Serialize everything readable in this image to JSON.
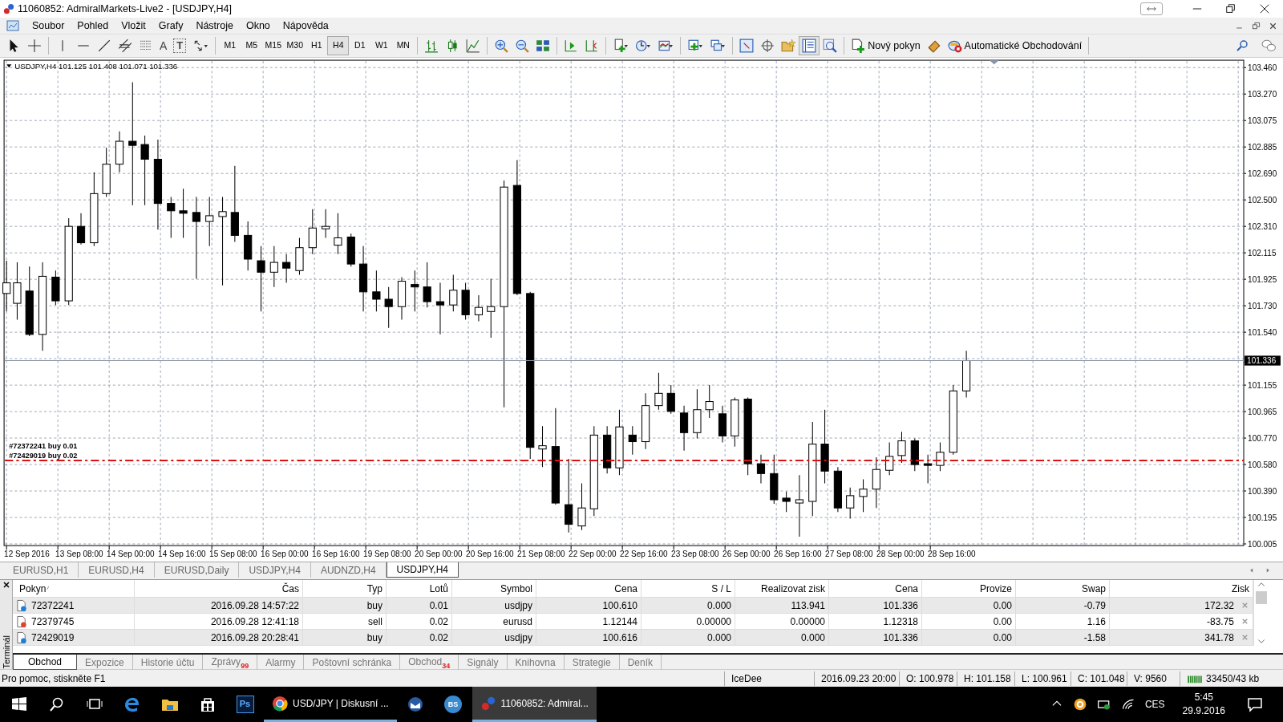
{
  "window": {
    "title": "11060852: AdmiralMarkets-Live2 - [USDJPY,H4]"
  },
  "menu": [
    "Soubor",
    "Pohled",
    "Vložit",
    "Grafy",
    "Nástroje",
    "Okno",
    "Nápověda"
  ],
  "toolbar": {
    "text_tool": "A",
    "label_tool": "T",
    "timeframes": [
      {
        "label": "M1",
        "selected": false
      },
      {
        "label": "M5",
        "selected": false
      },
      {
        "label": "M15",
        "selected": false
      },
      {
        "label": "M30",
        "selected": false
      },
      {
        "label": "H1",
        "selected": false
      },
      {
        "label": "H4",
        "selected": true
      },
      {
        "label": "D1",
        "selected": false
      },
      {
        "label": "W1",
        "selected": false
      },
      {
        "label": "MN",
        "selected": false
      }
    ],
    "new_order": "Nový pokyn",
    "auto_trading": "Automatické Obchodování"
  },
  "chart": {
    "header": "USDJPY,H4  101.125 101.408 101.071 101.336",
    "price_labels": [
      "103.460",
      "103.270",
      "103.075",
      "102.885",
      "102.690",
      "102.500",
      "102.310",
      "102.115",
      "101.925",
      "101.730",
      "101.540",
      "101.155",
      "100.965",
      "100.770",
      "100.580",
      "100.390",
      "100.195",
      "100.005"
    ],
    "current_price": "101.336",
    "order_labels": [
      "#72372241 buy 0.01",
      "#72429019 buy 0.02"
    ],
    "time_labels": [
      "12 Sep 2016",
      "13 Sep 08:00",
      "14 Sep 00:00",
      "14 Sep 16:00",
      "15 Sep 08:00",
      "16 Sep 00:00",
      "16 Sep 16:00",
      "19 Sep 08:00",
      "20 Sep 00:00",
      "20 Sep 16:00",
      "21 Sep 08:00",
      "22 Sep 00:00",
      "22 Sep 16:00",
      "23 Sep 08:00",
      "26 Sep 00:00",
      "26 Sep 16:00",
      "27 Sep 08:00",
      "28 Sep 00:00",
      "28 Sep 16:00"
    ]
  },
  "chart_tabs": [
    {
      "label": "EURUSD,H1",
      "selected": false
    },
    {
      "label": "EURUSD,H4",
      "selected": false
    },
    {
      "label": "EURUSD,Daily",
      "selected": false
    },
    {
      "label": "USDJPY,H4",
      "selected": false
    },
    {
      "label": "AUDNZD,H4",
      "selected": false
    },
    {
      "label": "USDJPY,H4",
      "selected": true
    }
  ],
  "terminal": {
    "title": "Terminál",
    "columns": [
      "Pokyn",
      "Čas",
      "Typ",
      "Lotů",
      "Symbol",
      "Cena",
      "S / L",
      "Realizovat zisk",
      "Cena",
      "Provize",
      "Swap",
      "Zisk"
    ],
    "rows": [
      {
        "color": "#1e7fd8",
        "cells": [
          "72372241",
          "2016.09.28 14:57:22",
          "buy",
          "0.01",
          "usdjpy",
          "100.610",
          "0.000",
          "113.941",
          "101.336",
          "0.00",
          "-0.79",
          "172.32"
        ]
      },
      {
        "color": "#e0452b",
        "cells": [
          "72379745",
          "2016.09.28 12:41:18",
          "sell",
          "0.02",
          "eurusd",
          "1.12144",
          "0.00000",
          "0.00000",
          "1.12318",
          "0.00",
          "1.16",
          "-83.75"
        ]
      },
      {
        "color": "#1e7fd8",
        "cells": [
          "72429019",
          "2016.09.28 20:28:41",
          "buy",
          "0.02",
          "usdjpy",
          "100.616",
          "0.000",
          "0.000",
          "101.336",
          "0.00",
          "-1.58",
          "341.78"
        ]
      }
    ],
    "tabs": [
      {
        "label": "Obchod",
        "selected": true
      },
      {
        "label": "Expozice",
        "selected": false
      },
      {
        "label": "Historie účtu",
        "selected": false
      },
      {
        "label": "Zprávy",
        "badge": "99",
        "selected": false
      },
      {
        "label": "Alarmy",
        "selected": false
      },
      {
        "label": "Poštovní schránka",
        "selected": false
      },
      {
        "label": "Obchod",
        "badge": "34",
        "selected": false
      },
      {
        "label": "Signály",
        "selected": false
      },
      {
        "label": "Knihovna",
        "selected": false
      },
      {
        "label": "Strategie",
        "selected": false
      },
      {
        "label": "Deník",
        "selected": false
      }
    ]
  },
  "status_bar": {
    "help": "Pro pomoc, stiskněte F1",
    "cells": [
      "IceDee",
      "2016.09.23 20:00",
      "O: 100.978",
      "H: 101.158",
      "L: 100.961",
      "C: 101.048",
      "V: 9560"
    ],
    "traffic": "33450/43 kb"
  },
  "taskbar": {
    "ps_icon": "Ps",
    "bs_icon": "BS",
    "tasks": [
      {
        "label": "USD/JPY | Diskusní ...",
        "selected": false
      },
      {
        "label": "11060852: Admiral...",
        "selected": true
      }
    ],
    "language": "CES",
    "time": "5:45",
    "date": "29.9.2016"
  }
}
